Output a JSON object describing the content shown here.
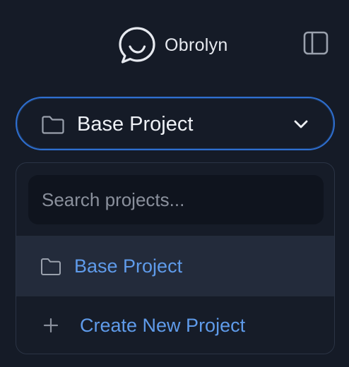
{
  "brand": {
    "name": "Obrolyn",
    "logo_icon": "chat-bubble-smile-icon"
  },
  "header": {
    "sidebar_toggle_icon": "sidebar-toggle-icon"
  },
  "project_selector": {
    "selected_label": "Base Project",
    "folder_icon": "folder-icon",
    "chevron_icon": "chevron-down-icon"
  },
  "dropdown": {
    "search": {
      "value": "",
      "placeholder": "Search projects..."
    },
    "options": [
      {
        "label": "Base Project",
        "icon": "folder-icon",
        "selected": true
      }
    ],
    "create": {
      "label": "Create New Project",
      "icon": "plus-icon"
    }
  },
  "colors": {
    "background": "#151b27",
    "accent": "#5f9bea",
    "focus_border": "#2f6fd0",
    "selected_row": "#232b3b",
    "text_primary": "#eef1f6",
    "text_muted": "#8a909c"
  }
}
